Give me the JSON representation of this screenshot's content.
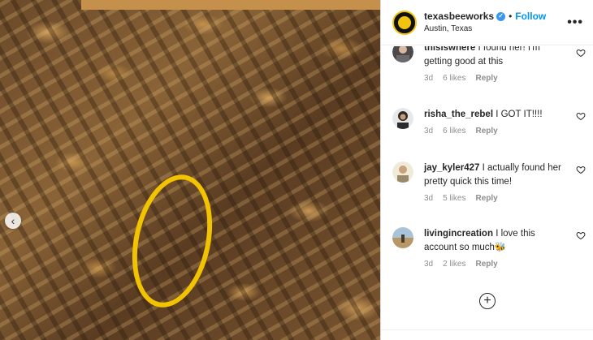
{
  "post": {
    "username": "texasbeeworks",
    "verified_mark": "✓",
    "separator": "•",
    "follow_label": "Follow",
    "location": "Austin, Texas",
    "more_label": "•••"
  },
  "carousel": {
    "prev_icon": "‹"
  },
  "comments": [
    {
      "username": "thisiswhere",
      "text": "I found her! I'm getting good at this",
      "age": "3d",
      "likes": "6 likes",
      "reply": "Reply",
      "avatar_color": "#4a4a4a"
    },
    {
      "username": "risha_the_rebel",
      "text": "I GOT IT!!!!",
      "age": "3d",
      "likes": "6 likes",
      "reply": "Reply",
      "avatar_color": "#2b2b2b"
    },
    {
      "username": "jay_kyler427",
      "text": "I actually found her pretty quick this time!",
      "age": "3d",
      "likes": "5 likes",
      "reply": "Reply",
      "avatar_color": "#c8b89a"
    },
    {
      "username": "livingincreation",
      "text": "I love this account so much🐝",
      "age": "3d",
      "likes": "2 likes",
      "reply": "Reply",
      "avatar_color": "#b89868"
    }
  ],
  "load_more_icon": "+"
}
